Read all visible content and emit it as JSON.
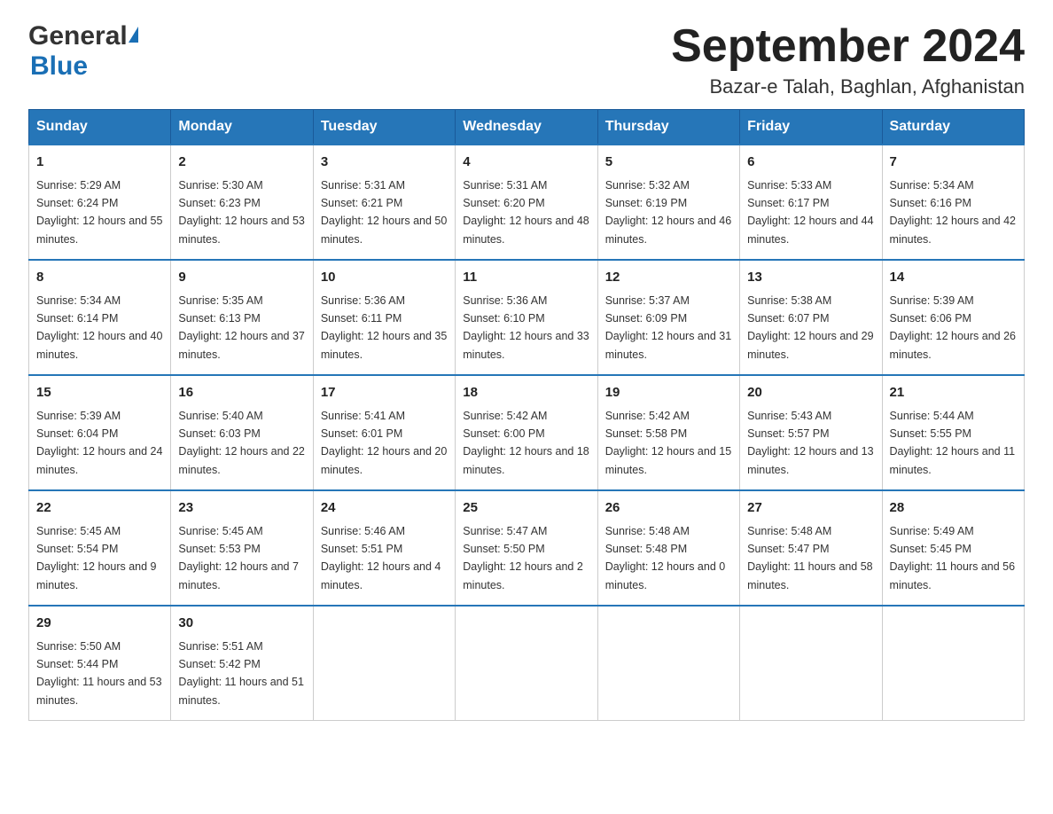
{
  "header": {
    "title": "September 2024",
    "subtitle": "Bazar-e Talah, Baghlan, Afghanistan",
    "logo_general": "General",
    "logo_blue": "Blue"
  },
  "days_of_week": [
    "Sunday",
    "Monday",
    "Tuesday",
    "Wednesday",
    "Thursday",
    "Friday",
    "Saturday"
  ],
  "weeks": [
    [
      {
        "day": "1",
        "sunrise": "5:29 AM",
        "sunset": "6:24 PM",
        "daylight": "12 hours and 55 minutes."
      },
      {
        "day": "2",
        "sunrise": "5:30 AM",
        "sunset": "6:23 PM",
        "daylight": "12 hours and 53 minutes."
      },
      {
        "day": "3",
        "sunrise": "5:31 AM",
        "sunset": "6:21 PM",
        "daylight": "12 hours and 50 minutes."
      },
      {
        "day": "4",
        "sunrise": "5:31 AM",
        "sunset": "6:20 PM",
        "daylight": "12 hours and 48 minutes."
      },
      {
        "day": "5",
        "sunrise": "5:32 AM",
        "sunset": "6:19 PM",
        "daylight": "12 hours and 46 minutes."
      },
      {
        "day": "6",
        "sunrise": "5:33 AM",
        "sunset": "6:17 PM",
        "daylight": "12 hours and 44 minutes."
      },
      {
        "day": "7",
        "sunrise": "5:34 AM",
        "sunset": "6:16 PM",
        "daylight": "12 hours and 42 minutes."
      }
    ],
    [
      {
        "day": "8",
        "sunrise": "5:34 AM",
        "sunset": "6:14 PM",
        "daylight": "12 hours and 40 minutes."
      },
      {
        "day": "9",
        "sunrise": "5:35 AM",
        "sunset": "6:13 PM",
        "daylight": "12 hours and 37 minutes."
      },
      {
        "day": "10",
        "sunrise": "5:36 AM",
        "sunset": "6:11 PM",
        "daylight": "12 hours and 35 minutes."
      },
      {
        "day": "11",
        "sunrise": "5:36 AM",
        "sunset": "6:10 PM",
        "daylight": "12 hours and 33 minutes."
      },
      {
        "day": "12",
        "sunrise": "5:37 AM",
        "sunset": "6:09 PM",
        "daylight": "12 hours and 31 minutes."
      },
      {
        "day": "13",
        "sunrise": "5:38 AM",
        "sunset": "6:07 PM",
        "daylight": "12 hours and 29 minutes."
      },
      {
        "day": "14",
        "sunrise": "5:39 AM",
        "sunset": "6:06 PM",
        "daylight": "12 hours and 26 minutes."
      }
    ],
    [
      {
        "day": "15",
        "sunrise": "5:39 AM",
        "sunset": "6:04 PM",
        "daylight": "12 hours and 24 minutes."
      },
      {
        "day": "16",
        "sunrise": "5:40 AM",
        "sunset": "6:03 PM",
        "daylight": "12 hours and 22 minutes."
      },
      {
        "day": "17",
        "sunrise": "5:41 AM",
        "sunset": "6:01 PM",
        "daylight": "12 hours and 20 minutes."
      },
      {
        "day": "18",
        "sunrise": "5:42 AM",
        "sunset": "6:00 PM",
        "daylight": "12 hours and 18 minutes."
      },
      {
        "day": "19",
        "sunrise": "5:42 AM",
        "sunset": "5:58 PM",
        "daylight": "12 hours and 15 minutes."
      },
      {
        "day": "20",
        "sunrise": "5:43 AM",
        "sunset": "5:57 PM",
        "daylight": "12 hours and 13 minutes."
      },
      {
        "day": "21",
        "sunrise": "5:44 AM",
        "sunset": "5:55 PM",
        "daylight": "12 hours and 11 minutes."
      }
    ],
    [
      {
        "day": "22",
        "sunrise": "5:45 AM",
        "sunset": "5:54 PM",
        "daylight": "12 hours and 9 minutes."
      },
      {
        "day": "23",
        "sunrise": "5:45 AM",
        "sunset": "5:53 PM",
        "daylight": "12 hours and 7 minutes."
      },
      {
        "day": "24",
        "sunrise": "5:46 AM",
        "sunset": "5:51 PM",
        "daylight": "12 hours and 4 minutes."
      },
      {
        "day": "25",
        "sunrise": "5:47 AM",
        "sunset": "5:50 PM",
        "daylight": "12 hours and 2 minutes."
      },
      {
        "day": "26",
        "sunrise": "5:48 AM",
        "sunset": "5:48 PM",
        "daylight": "12 hours and 0 minutes."
      },
      {
        "day": "27",
        "sunrise": "5:48 AM",
        "sunset": "5:47 PM",
        "daylight": "11 hours and 58 minutes."
      },
      {
        "day": "28",
        "sunrise": "5:49 AM",
        "sunset": "5:45 PM",
        "daylight": "11 hours and 56 minutes."
      }
    ],
    [
      {
        "day": "29",
        "sunrise": "5:50 AM",
        "sunset": "5:44 PM",
        "daylight": "11 hours and 53 minutes."
      },
      {
        "day": "30",
        "sunrise": "5:51 AM",
        "sunset": "5:42 PM",
        "daylight": "11 hours and 51 minutes."
      },
      null,
      null,
      null,
      null,
      null
    ]
  ]
}
